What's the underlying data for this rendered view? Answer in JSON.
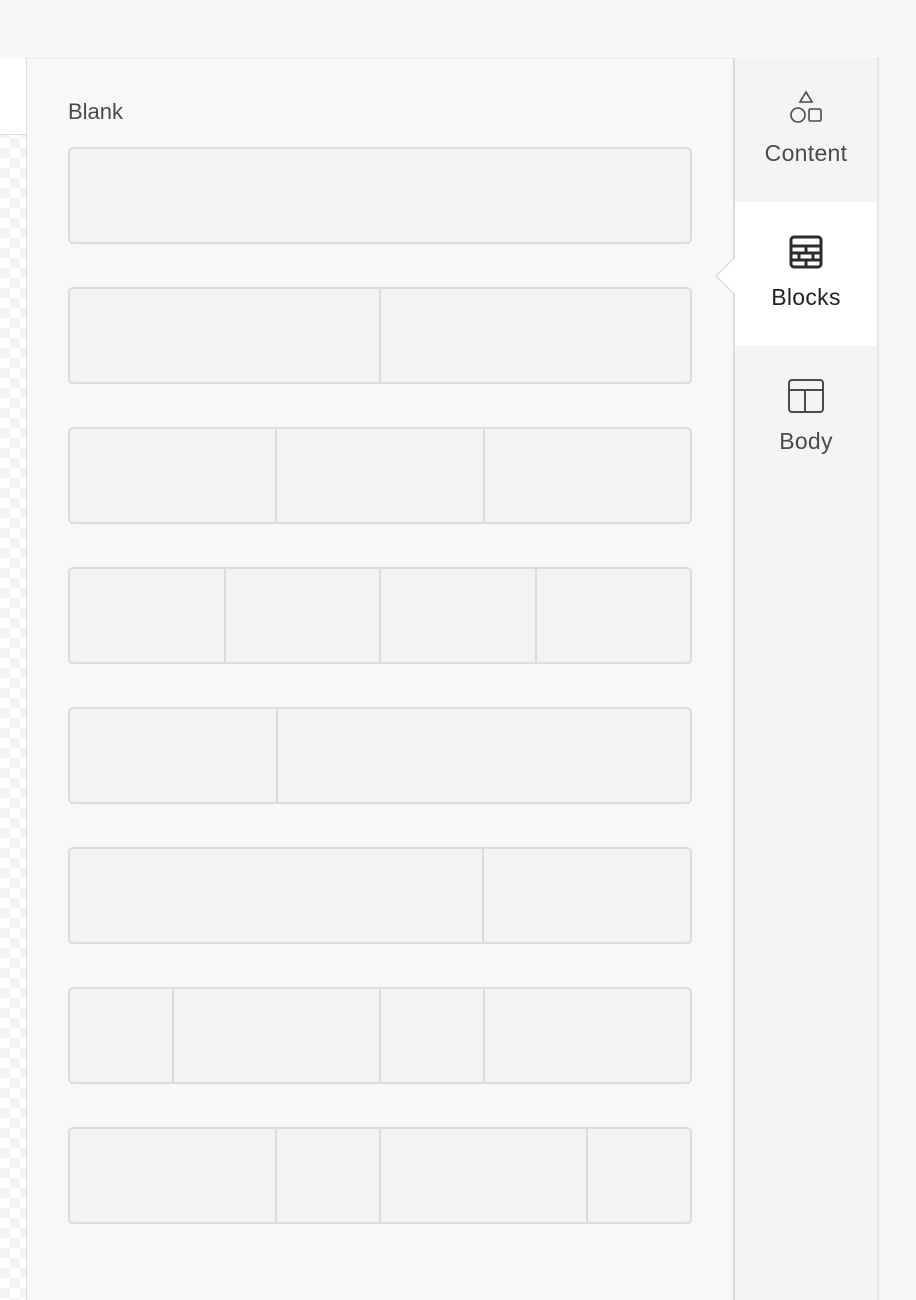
{
  "panel": {
    "label": "Blank"
  },
  "layouts": [
    {
      "name": "layout-1-col",
      "columns": [
        1
      ]
    },
    {
      "name": "layout-2-col",
      "columns": [
        1,
        1
      ]
    },
    {
      "name": "layout-3-col",
      "columns": [
        1,
        1,
        1
      ]
    },
    {
      "name": "layout-4-col",
      "columns": [
        1,
        1,
        1,
        1
      ]
    },
    {
      "name": "layout-1-2",
      "columns": [
        1,
        2
      ]
    },
    {
      "name": "layout-2-1",
      "columns": [
        2,
        1
      ]
    },
    {
      "name": "layout-1-2-1-2",
      "columns": [
        1,
        2,
        1,
        2
      ]
    },
    {
      "name": "layout-2-1-2-1",
      "columns": [
        2,
        1,
        2,
        1
      ]
    }
  ],
  "tabs": [
    {
      "id": "content",
      "label": "Content",
      "icon": "shapes-icon",
      "active": false
    },
    {
      "id": "blocks",
      "label": "Blocks",
      "icon": "blocks-icon",
      "active": true
    },
    {
      "id": "body",
      "label": "Body",
      "icon": "layout-icon",
      "active": false
    }
  ],
  "colors": {
    "panel_bg": "#f8f8f8",
    "block_bg": "#f3f3f3",
    "block_border": "#dcdcdc",
    "active_tab_bg": "#ffffff"
  }
}
